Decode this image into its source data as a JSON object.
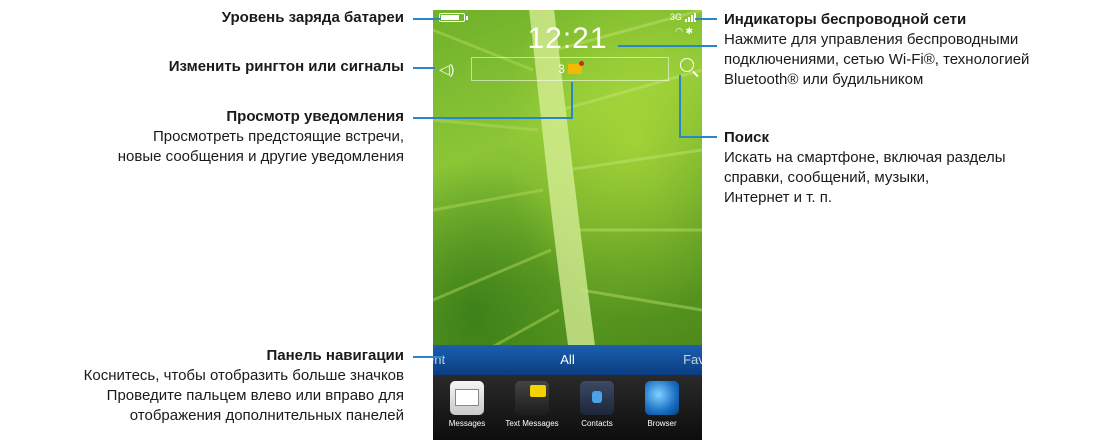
{
  "callouts": {
    "battery": {
      "title": "Уровень заряда батареи"
    },
    "ringtone": {
      "title": "Изменить рингтон или сигналы"
    },
    "notifications": {
      "title": "Просмотр уведомления",
      "line1": "Просмотреть предстоящие встречи,",
      "line2": "новые сообщения и другие уведомления"
    },
    "navbar": {
      "title": "Панель навигации",
      "line1": "Коснитесь, чтобы отобразить больше значков",
      "line2": "Проведите пальцем влево или вправо для",
      "line3": "отображения дополнительных панелей"
    },
    "wireless": {
      "title": "Индикаторы беспроводной сети",
      "line1": "Нажмите для управления беспроводными",
      "line2": "подключениями, сетью Wi-Fi®, технологией",
      "line3": "Bluetooth® или будильником"
    },
    "search": {
      "title": "Поиск",
      "line1": "Искать на смартфоне, включая разделы",
      "line2": "справки, сообщений, музыки,",
      "line3": "Интернет и т. п."
    }
  },
  "phone": {
    "network": "3G",
    "time": "12:21",
    "notification_count": "3",
    "tabs": {
      "left": "ent",
      "center": "All",
      "right": "Favo"
    },
    "apps": [
      {
        "label": "Messages",
        "icon": "mail-icon"
      },
      {
        "label": "Text Messages",
        "icon": "text-messages-icon"
      },
      {
        "label": "Contacts",
        "icon": "contacts-icon"
      },
      {
        "label": "Browser",
        "icon": "browser-icon"
      }
    ],
    "battery_level": 0.9
  },
  "colors": {
    "callout_line": "#2a86c9",
    "nav_bar": "#1b5fb0",
    "leaf": "#8cc637"
  }
}
